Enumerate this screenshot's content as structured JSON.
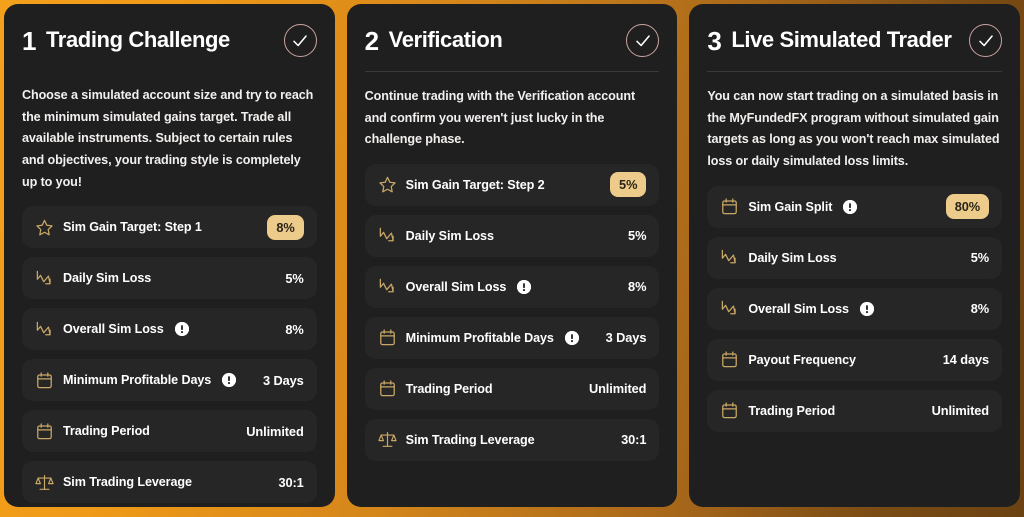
{
  "theme": {
    "background_gradient_from": "#f3a01c",
    "background_gradient_to": "#6b4212",
    "card_bg": "#201F1F",
    "row_bg": "#272626",
    "badge_bg": "#edcc8b",
    "icon_gold": "#c9a765",
    "check_ring": "#c9a3a0"
  },
  "cards": [
    {
      "number": "1",
      "title": "Trading Challenge",
      "check_icon": "check-icon",
      "description": "Choose a simulated account size and try to reach the minimum simulated gains target. Trade all available instruments. Subject to certain rules and objectives, your trading style is completely up to you!",
      "rows": [
        {
          "icon": "star-icon",
          "label": "Sim Gain Target: Step 1",
          "info": false,
          "value": "8%",
          "badge": true
        },
        {
          "icon": "loss-chart-icon",
          "label": "Daily Sim Loss",
          "info": false,
          "value": "5%",
          "badge": false
        },
        {
          "icon": "loss-chart-icon",
          "label": "Overall Sim Loss",
          "info": true,
          "value": "8%",
          "badge": false
        },
        {
          "icon": "calendar-icon",
          "label": "Minimum Profitable Days",
          "info": true,
          "value": "3 Days",
          "badge": false
        },
        {
          "icon": "calendar-icon",
          "label": "Trading Period",
          "info": false,
          "value": "Unlimited",
          "badge": false
        },
        {
          "icon": "scales-icon",
          "label": "Sim Trading Leverage",
          "info": false,
          "value": "30:1",
          "badge": false
        }
      ]
    },
    {
      "number": "2",
      "title": "Verification",
      "check_icon": "check-icon",
      "description": "Continue trading with the Verification account and confirm you weren't just lucky in the challenge phase.",
      "rows": [
        {
          "icon": "star-icon",
          "label": "Sim Gain Target: Step 2",
          "info": false,
          "value": "5%",
          "badge": true
        },
        {
          "icon": "loss-chart-icon",
          "label": "Daily Sim Loss",
          "info": false,
          "value": "5%",
          "badge": false
        },
        {
          "icon": "loss-chart-icon",
          "label": "Overall Sim Loss",
          "info": true,
          "value": "8%",
          "badge": false
        },
        {
          "icon": "calendar-icon",
          "label": "Minimum Profitable Days",
          "info": true,
          "value": "3 Days",
          "badge": false
        },
        {
          "icon": "calendar-icon",
          "label": "Trading Period",
          "info": false,
          "value": "Unlimited",
          "badge": false
        },
        {
          "icon": "scales-icon",
          "label": "Sim Trading Leverage",
          "info": false,
          "value": "30:1",
          "badge": false
        }
      ]
    },
    {
      "number": "3",
      "title": "Live Simulated Trader",
      "check_icon": "check-icon",
      "description": "You can now start trading on a simulated basis in the MyFundedFX program without simulated gain targets as long as you won't reach max simulated loss or daily simulated loss limits.",
      "rows": [
        {
          "icon": "calendar-icon",
          "label": "Sim Gain Split",
          "info": true,
          "value": "80%",
          "badge": true
        },
        {
          "icon": "loss-chart-icon",
          "label": "Daily Sim Loss",
          "info": false,
          "value": "5%",
          "badge": false
        },
        {
          "icon": "loss-chart-icon",
          "label": "Overall Sim Loss",
          "info": true,
          "value": "8%",
          "badge": false
        },
        {
          "icon": "calendar-icon",
          "label": "Payout Frequency",
          "info": false,
          "value": "14 days",
          "badge": false
        },
        {
          "icon": "calendar-icon",
          "label": "Trading Period",
          "info": false,
          "value": "Unlimited",
          "badge": false
        }
      ]
    }
  ]
}
